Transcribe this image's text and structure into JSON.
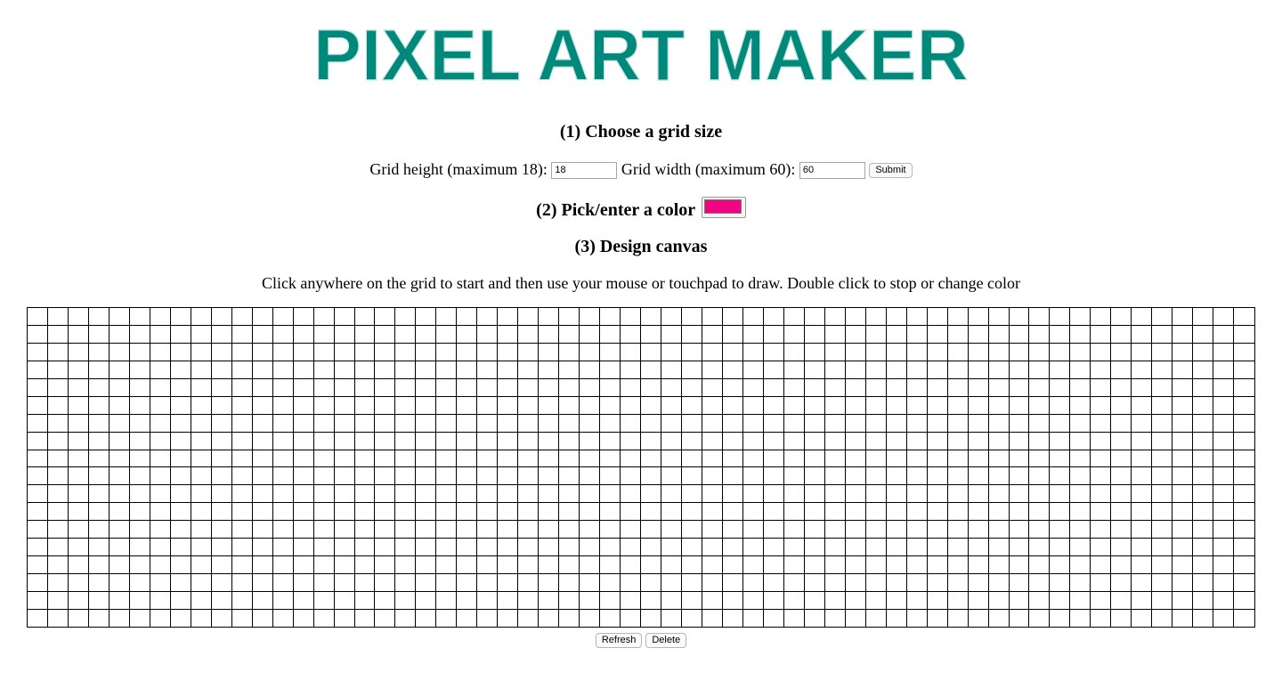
{
  "header": {
    "title": "PIXEL ART MAKER",
    "title_color": "#00897b"
  },
  "step1": {
    "heading": "(1) Choose a grid size",
    "height_label": "Grid height (maximum 18):",
    "height_value": "18",
    "width_label": "Grid width (maximum 60):",
    "width_value": "60",
    "submit_label": "Submit"
  },
  "step2": {
    "heading": "(2) Pick/enter a color",
    "color_value": "#f0047f"
  },
  "step3": {
    "heading": "(3) Design canvas",
    "instructions": "Click anywhere on the grid to start and then use your mouse or touchpad to draw. Double click to stop or change color"
  },
  "canvas": {
    "rows": 18,
    "cols": 60,
    "cell_color": "#ffffff",
    "line_color": "#000000"
  },
  "actions": {
    "refresh_label": "Refresh",
    "delete_label": "Delete"
  }
}
